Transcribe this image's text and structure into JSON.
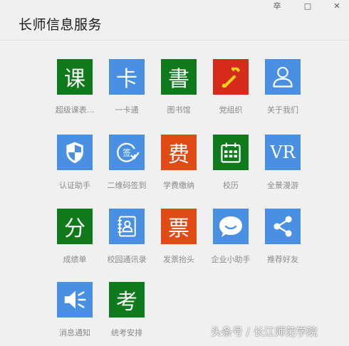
{
  "window": {
    "title": "长师信息服务",
    "controls": {
      "pin": "卒",
      "minimize": "□",
      "close": "✕"
    }
  },
  "colors": {
    "green": "#0f7a1b",
    "blue": "#4a90e2",
    "red": "#e04a14",
    "chinese_red": "#d62a1a",
    "label": "#8a8a8a"
  },
  "apps": [
    {
      "label": "超级课表...",
      "glyph": "课",
      "icon": "kebiao-char-icon",
      "color": "green"
    },
    {
      "label": "一卡通",
      "glyph": "卡",
      "icon": "card-char-icon",
      "color": "blue"
    },
    {
      "label": "图书馆",
      "glyph": "書",
      "icon": "library-char-icon",
      "color": "green"
    },
    {
      "label": "党组织",
      "glyph": "",
      "icon": "hammer-sickle-icon",
      "color": "chinese_red"
    },
    {
      "label": "关于我们",
      "glyph": "",
      "icon": "user-icon",
      "color": "blue"
    },
    {
      "label": "认证助手",
      "glyph": "",
      "icon": "shield-icon",
      "color": "blue"
    },
    {
      "label": "二维码签到",
      "glyph": "签",
      "icon": "checkin-icon",
      "color": "blue"
    },
    {
      "label": "学费缴纳",
      "glyph": "费",
      "icon": "fee-char-icon",
      "color": "red"
    },
    {
      "label": "校历",
      "glyph": "",
      "icon": "calendar-icon",
      "color": "green"
    },
    {
      "label": "全景漫游",
      "glyph": "VR",
      "icon": "vr-icon",
      "color": "blue"
    },
    {
      "label": "成绩单",
      "glyph": "分",
      "icon": "score-char-icon",
      "color": "green"
    },
    {
      "label": "校园通讯录",
      "glyph": "",
      "icon": "contacts-book-icon",
      "color": "blue"
    },
    {
      "label": "发票抬头",
      "glyph": "票",
      "icon": "invoice-char-icon",
      "color": "red"
    },
    {
      "label": "企业小助手",
      "glyph": "",
      "icon": "chat-bubble-icon",
      "color": "blue"
    },
    {
      "label": "推荐好友",
      "glyph": "",
      "icon": "share-icon",
      "color": "blue"
    },
    {
      "label": "消息通知",
      "glyph": "",
      "icon": "speaker-icon",
      "color": "blue"
    },
    {
      "label": "统考安排",
      "glyph": "考",
      "icon": "exam-char-icon",
      "color": "green"
    }
  ],
  "watermark": "头条号 / 长江师范学院"
}
